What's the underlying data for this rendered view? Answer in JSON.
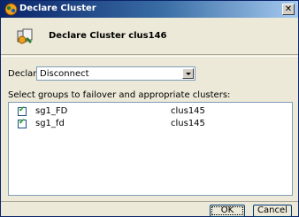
{
  "window": {
    "title": "Declare Cluster",
    "close_label": "✕"
  },
  "header": {
    "title": "Declare Cluster clus146"
  },
  "declare": {
    "label": "Declare",
    "selected": "Disconnect"
  },
  "groups": {
    "label": "Select groups to failover and appropriate clusters:",
    "rows": [
      {
        "group": "sg1_FD",
        "cluster": "clus145",
        "checked": true
      },
      {
        "group": "sg1_fd",
        "cluster": "clus145",
        "checked": true
      }
    ]
  },
  "buttons": {
    "ok": "OK",
    "cancel": "Cancel"
  },
  "colors": {
    "titlebar_start": "#0a246a",
    "titlebar_end": "#a6caf0",
    "dialog_bg": "#ece9d8",
    "checkmark": "#21a121"
  },
  "icons": {
    "app": "cluster-app-icon",
    "header": "declare-cluster-icon",
    "check": "checkmark-icon",
    "dropdown": "chevron-down-icon"
  }
}
